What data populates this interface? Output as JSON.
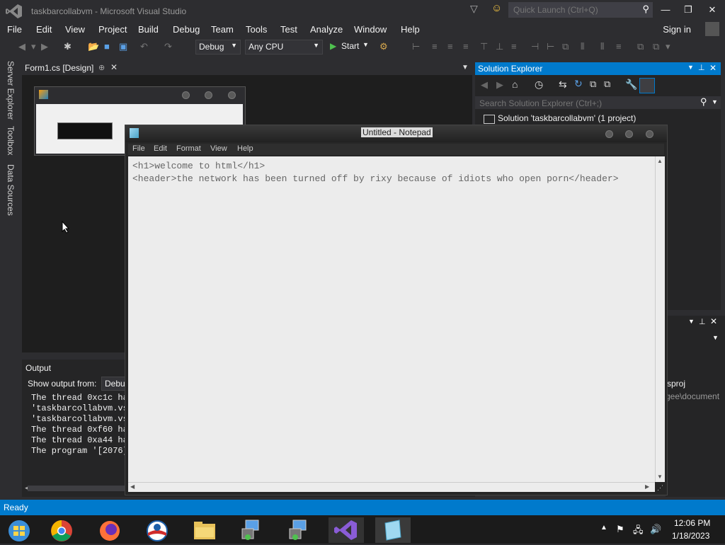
{
  "vs": {
    "title": "taskbarcollabvm - Microsoft Visual Studio",
    "quick_launch_placeholder": "Quick Launch (Ctrl+Q)",
    "menu": [
      "File",
      "Edit",
      "View",
      "Project",
      "Build",
      "Debug",
      "Team",
      "Tools",
      "Test",
      "Analyze",
      "Window",
      "Help"
    ],
    "sign_in": "Sign in",
    "toolbar": {
      "config": "Debug",
      "platform": "Any CPU",
      "start_label": "Start"
    },
    "side_tabs": [
      "Server Explorer",
      "Toolbox",
      "Data Sources"
    ],
    "editor_tab": "Form1.cs [Design]",
    "output": {
      "title": "Output",
      "show_from_label": "Show output from:",
      "source": "Debu",
      "lines": [
        "The thread 0xc1c ha",
        "'taskbarcollabvm.vs",
        "'taskbarcollabvm.vs",
        "The thread 0xf60 ha",
        "The thread 0xa44 ha",
        "The program '[2076]"
      ]
    },
    "solution_explorer": {
      "title": "Solution Explorer",
      "search_placeholder": "Search Solution Explorer (Ctrl+;)",
      "solution_item": "Solution 'taskbarcollabvm' (1 project)",
      "partial_1": "sproj",
      "partial_2": "gee\\document"
    },
    "status": "Ready"
  },
  "notepad": {
    "title": "Untitled - Notepad",
    "menu": [
      "File",
      "Edit",
      "Format",
      "View",
      "Help"
    ],
    "lines": [
      "<h1>welcome to html</h1>",
      "<header>the network has been turned off by rixy because of idiots who open porn</header>"
    ]
  },
  "taskbar": {
    "time": "12:06 PM",
    "date": "1/18/2023",
    "apps": [
      "start-icon",
      "chrome-icon",
      "firefox-icon",
      "obama-icon",
      "file-explorer-icon",
      "network-setup-icon",
      "network-setup-2-icon",
      "visual-studio-icon",
      "notepad-icon"
    ]
  },
  "colors": {
    "accent": "#007acc",
    "vs_bg": "#2d2d30",
    "editor_bg": "#1e1e1e",
    "taskbar": "#1b1b1b"
  }
}
